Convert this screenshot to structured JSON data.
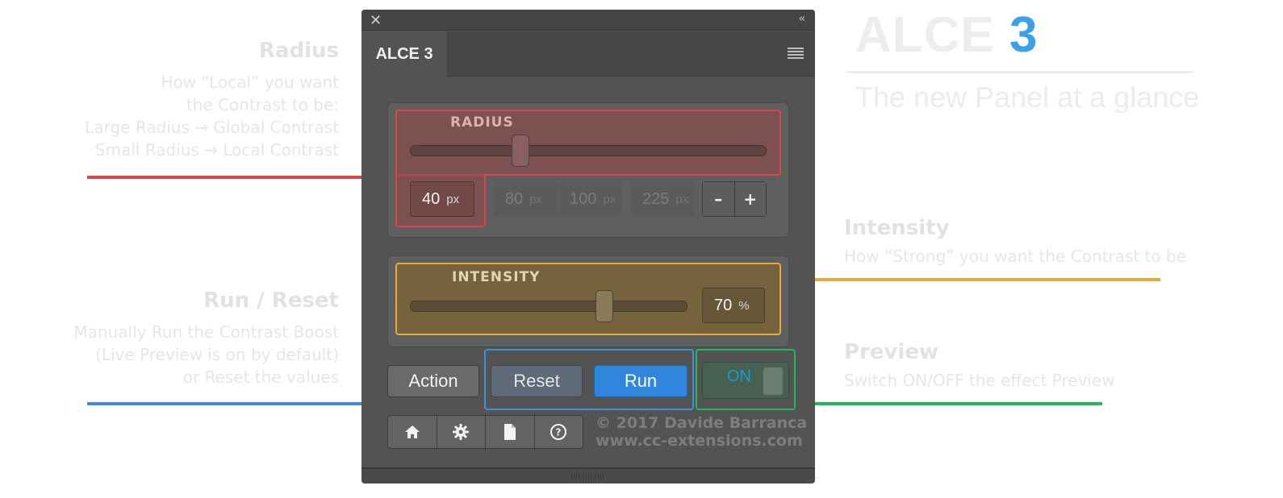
{
  "annotations": {
    "radius": {
      "title": "Radius",
      "lines": [
        "How “Local” you want",
        "the Contrast to be:",
        "Large Radius → Global Contrast",
        "Small Radius → Local Contrast"
      ],
      "color": "#d94848"
    },
    "run_reset": {
      "title": "Run / Reset",
      "lines": [
        "Manually Run the Contrast Boost",
        "(Live Preview is on by default)",
        "or Reset the values"
      ],
      "color": "#3c8fd6"
    },
    "intensity": {
      "title": "Intensity",
      "lines": [
        "How “Strong” you want the Contrast to be"
      ],
      "color": "#e6a93a"
    },
    "preview": {
      "title": "Preview",
      "lines": [
        "Switch ON/OFF the effect Preview"
      ],
      "color": "#22b860"
    }
  },
  "brand": {
    "name": "ALCE",
    "number": "3",
    "tagline": "The new Panel at a glance"
  },
  "panel": {
    "close": "✕",
    "collapse": "‹‹",
    "tab": "ALCE 3",
    "radius": {
      "label": "RADIUS",
      "value": "40",
      "unit": "px",
      "slider_fraction": 0.31,
      "presets": [
        {
          "value": "80",
          "unit": "px"
        },
        {
          "value": "100",
          "unit": "px"
        },
        {
          "value": "225",
          "unit": "px"
        }
      ],
      "minus": "–",
      "plus": "+"
    },
    "intensity": {
      "label": "INTENSITY",
      "value": "70",
      "unit": "%",
      "slider_fraction": 0.7
    },
    "buttons": {
      "action": "Action",
      "reset": "Reset",
      "run": "Run"
    },
    "preview_toggle": {
      "label": "ON",
      "state": "on"
    },
    "icons": [
      "home-icon",
      "gear-icon",
      "document-icon",
      "help-icon"
    ],
    "credit": {
      "line1": "© 2017 Davide Barranca",
      "line2": "www.cc-extensions.com"
    }
  }
}
